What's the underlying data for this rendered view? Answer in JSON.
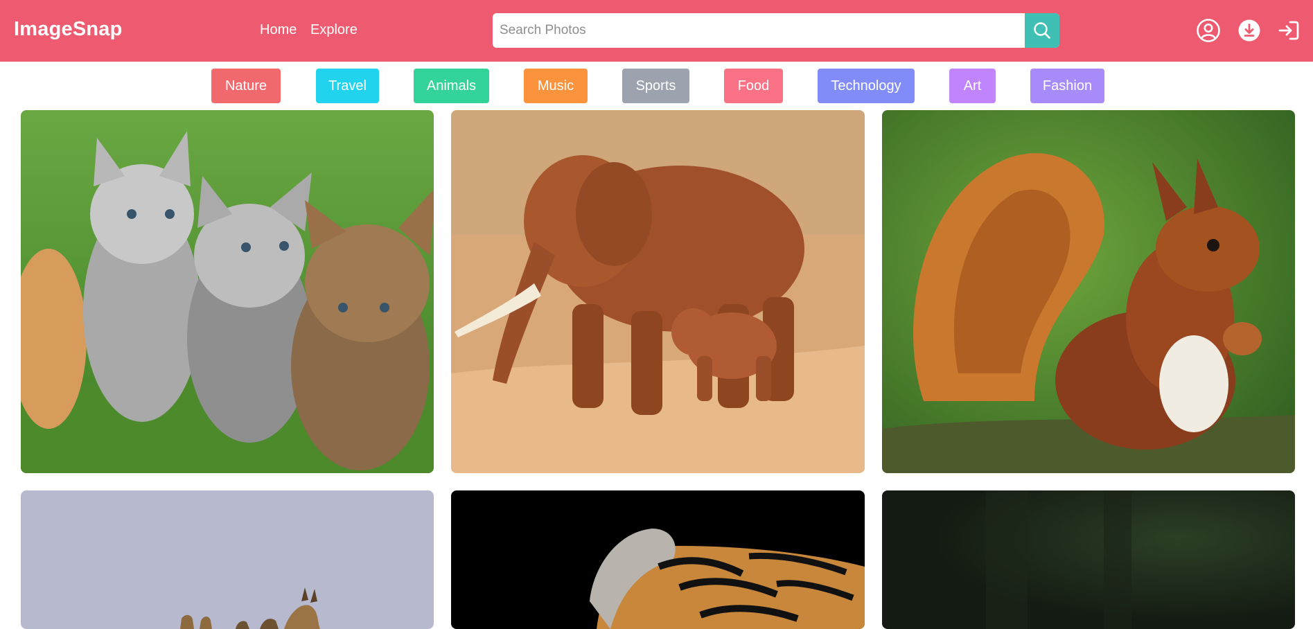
{
  "header": {
    "brand": "ImageSnap",
    "nav": [
      {
        "label": "Home"
      },
      {
        "label": "Explore"
      }
    ],
    "search": {
      "placeholder": "Search Photos",
      "value": ""
    },
    "icons": [
      "user-icon",
      "download-icon",
      "login-icon",
      "search-icon"
    ],
    "background_color": "#ee5a6f",
    "search_button_color": "#40c0b5"
  },
  "categories": [
    {
      "label": "Nature",
      "color": "#f2696d"
    },
    {
      "label": "Travel",
      "color": "#22d3ee"
    },
    {
      "label": "Animals",
      "color": "#34d399"
    },
    {
      "label": "Music",
      "color": "#fb923c"
    },
    {
      "label": "Sports",
      "color": "#9ca3af"
    },
    {
      "label": "Food",
      "color": "#fb7185"
    },
    {
      "label": "Technology",
      "color": "#818cf8"
    },
    {
      "label": "Art",
      "color": "#c084fc"
    },
    {
      "label": "Fashion",
      "color": "#a78bfa"
    }
  ],
  "gallery": [
    {
      "subject": "kittens"
    },
    {
      "subject": "elephants"
    },
    {
      "subject": "squirrel"
    },
    {
      "subject": "giraffes"
    },
    {
      "subject": "tiger"
    },
    {
      "subject": "forest"
    }
  ]
}
